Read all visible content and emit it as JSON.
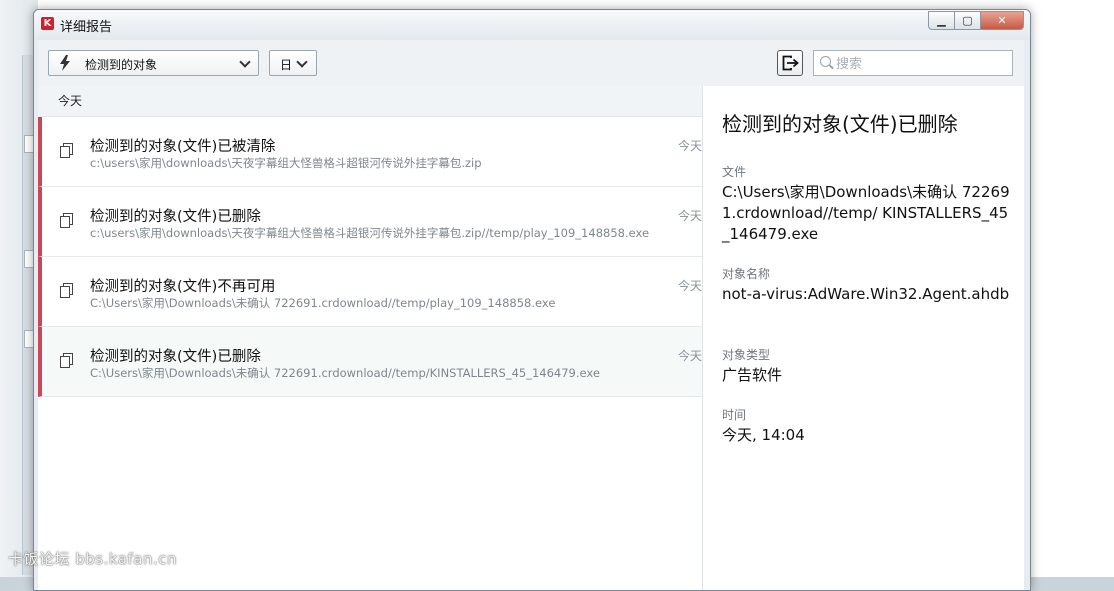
{
  "window": {
    "title": "详细报告",
    "app_icon_letter": "K",
    "buttons": {
      "minimize": "▁",
      "maximize": "▢",
      "close": "✕"
    }
  },
  "toolbar": {
    "filter_dropdown": {
      "icon": "lightning-icon",
      "value": "检测到的对象"
    },
    "period_dropdown": {
      "value": "日"
    },
    "export_button": {
      "icon": "export-icon"
    },
    "search": {
      "placeholder": "搜索",
      "value": ""
    }
  },
  "list": {
    "group_label": "今天",
    "items": [
      {
        "title": "检测到的对象(文件)已被清除",
        "path": "c:\\users\\家用\\downloads\\天夜字幕组大怪兽格斗超银河传说外挂字幕包.zip",
        "time": "今天"
      },
      {
        "title": "检测到的对象(文件)已删除",
        "path": "c:\\users\\家用\\downloads\\天夜字幕组大怪兽格斗超银河传说外挂字幕包.zip//temp/play_109_148858.exe",
        "time": "今天"
      },
      {
        "title": "检测到的对象(文件)不再可用",
        "path": "C:\\Users\\家用\\Downloads\\未确认 722691.crdownload//temp/play_109_148858.exe",
        "time": "今天"
      },
      {
        "title": "检测到的对象(文件)已删除",
        "path": "C:\\Users\\家用\\Downloads\\未确认 722691.crdownload//temp/KINSTALLERS_45_146479.exe",
        "time": "今天"
      }
    ]
  },
  "details": {
    "title": "检测到的对象(文件)已删除",
    "file_label": "文件",
    "file_value": "C:\\Users\\家用\\Downloads\\未确认 722691.crdownload//temp/ KINSTALLERS_45_146479.exe",
    "object_name_label": "对象名称",
    "object_name_value": "not-a-virus:AdWare.Win32.Agent.ahdb",
    "object_type_label": "对象类型",
    "object_type_value": "广告软件",
    "time_label": "时间",
    "time_value": "今天, 14:04"
  },
  "watermark": "卡饭论坛 bbs.kafan.cn",
  "colors": {
    "item_accent": "#c8485a",
    "app_icon": "#d21f2e",
    "close_button": "#c75a45"
  }
}
